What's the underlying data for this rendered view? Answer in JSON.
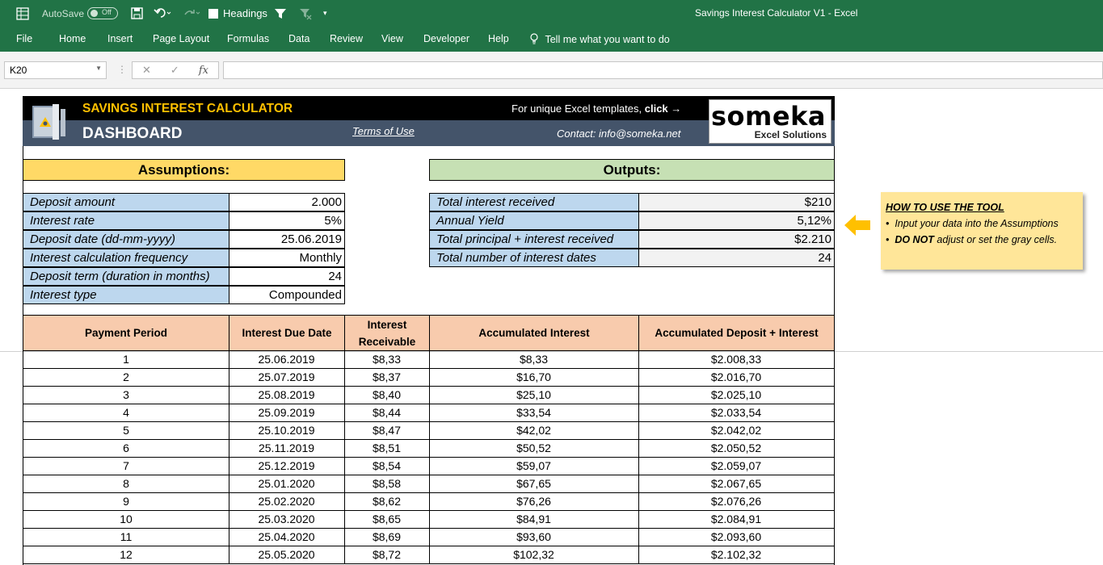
{
  "titlebar": {
    "autosave_label": "AutoSave",
    "autosave_state": "Off",
    "headings_label": "Headings",
    "window_title": "Savings Interest Calculator V1  -  Excel"
  },
  "ribbon": {
    "tabs": [
      "File",
      "Home",
      "Insert",
      "Page Layout",
      "Formulas",
      "Data",
      "Review",
      "View",
      "Developer",
      "Help"
    ],
    "tell_me": "Tell me what you want to do"
  },
  "formula_bar": {
    "name_box": "K20",
    "fx_label": "fx",
    "formula": ""
  },
  "header": {
    "title": "SAVINGS INTEREST CALCULATOR",
    "subtitle": "DASHBOARD",
    "terms": "Terms of Use",
    "unique_templates": "For unique Excel templates, ",
    "click": "click →",
    "contact": "Contact: info@someka.net",
    "logo_big": "someka",
    "logo_small": "Excel Solutions"
  },
  "assumptions": {
    "title": "Assumptions:",
    "rows": [
      {
        "label": "Deposit amount",
        "value": "2.000"
      },
      {
        "label": "Interest rate",
        "value": "5%"
      },
      {
        "label": "Deposit date (dd-mm-yyyy)",
        "value": "25.06.2019"
      },
      {
        "label": "Interest calculation frequency",
        "value": "Monthly"
      },
      {
        "label": "Deposit term (duration in months)",
        "value": "24"
      },
      {
        "label": "Interest type",
        "value": "Compounded"
      }
    ]
  },
  "outputs": {
    "title": "Outputs:",
    "rows": [
      {
        "label": "Total interest received",
        "value": "$210"
      },
      {
        "label": "Annual Yield",
        "value": "5,12%"
      },
      {
        "label": "Total principal + interest received",
        "value": "$2.210"
      },
      {
        "label": "Total number of interest dates",
        "value": "24"
      }
    ]
  },
  "howto": {
    "title": "HOW TO USE THE TOOL",
    "line1": "Input your data into the Assumptions",
    "line2_bold": "DO NOT",
    "line2_rest": " adjust or set the gray cells."
  },
  "table": {
    "headers": [
      "Payment Period",
      "Interest Due Date",
      "Interest Receivable",
      "Accumulated Interest",
      "Accumulated Deposit + Interest"
    ],
    "header_receivable_1": "Interest",
    "header_receivable_2": "Receivable",
    "rows": [
      {
        "period": "1",
        "date": "25.06.2019",
        "receivable": "$8,33",
        "accumulated": "$8,33",
        "total": "$2.008,33"
      },
      {
        "period": "2",
        "date": "25.07.2019",
        "receivable": "$8,37",
        "accumulated": "$16,70",
        "total": "$2.016,70"
      },
      {
        "period": "3",
        "date": "25.08.2019",
        "receivable": "$8,40",
        "accumulated": "$25,10",
        "total": "$2.025,10"
      },
      {
        "period": "4",
        "date": "25.09.2019",
        "receivable": "$8,44",
        "accumulated": "$33,54",
        "total": "$2.033,54"
      },
      {
        "period": "5",
        "date": "25.10.2019",
        "receivable": "$8,47",
        "accumulated": "$42,02",
        "total": "$2.042,02"
      },
      {
        "period": "6",
        "date": "25.11.2019",
        "receivable": "$8,51",
        "accumulated": "$50,52",
        "total": "$2.050,52"
      },
      {
        "period": "7",
        "date": "25.12.2019",
        "receivable": "$8,54",
        "accumulated": "$59,07",
        "total": "$2.059,07"
      },
      {
        "period": "8",
        "date": "25.01.2020",
        "receivable": "$8,58",
        "accumulated": "$67,65",
        "total": "$2.067,65"
      },
      {
        "period": "9",
        "date": "25.02.2020",
        "receivable": "$8,62",
        "accumulated": "$76,26",
        "total": "$2.076,26"
      },
      {
        "period": "10",
        "date": "25.03.2020",
        "receivable": "$8,65",
        "accumulated": "$84,91",
        "total": "$2.084,91"
      },
      {
        "period": "11",
        "date": "25.04.2020",
        "receivable": "$8,69",
        "accumulated": "$93,60",
        "total": "$2.093,60"
      },
      {
        "period": "12",
        "date": "25.05.2020",
        "receivable": "$8,72",
        "accumulated": "$102,32",
        "total": "$2.102,32"
      }
    ]
  },
  "colors": {
    "excel_green": "#217346",
    "assumptions_head": "#ffd966",
    "outputs_head": "#c6e0b4",
    "label_blue": "#bdd7ee",
    "table_head": "#f8cbad",
    "gray_value": "#f2f2f2",
    "header_dark": "#44546a",
    "accent_orange": "#ffc000"
  }
}
